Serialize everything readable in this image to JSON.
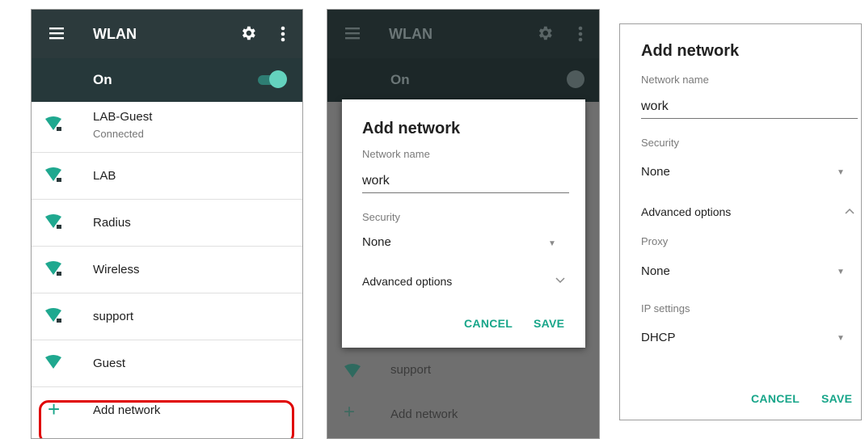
{
  "colors": {
    "appbar": "#2c3a3c",
    "accent": "#17a589",
    "wifi_icon": "#1fa88f",
    "highlight": "#e00000"
  },
  "wlan_screen": {
    "title": "WLAN",
    "status": "On",
    "networks": [
      {
        "name": "LAB-Guest",
        "status": "Connected"
      },
      {
        "name": "LAB"
      },
      {
        "name": "Radius"
      },
      {
        "name": "Wireless"
      },
      {
        "name": "support"
      },
      {
        "name": "Guest"
      }
    ],
    "add_network": "Add network"
  },
  "background_screen": {
    "title": "WLAN",
    "status": "On",
    "support": "support",
    "add_network": "Add network"
  },
  "dialog_basic": {
    "title": "Add network",
    "network_name_label": "Network name",
    "network_name_value": "work",
    "security_label": "Security",
    "security_value": "None",
    "advanced_label": "Advanced options",
    "cancel": "CANCEL",
    "save": "SAVE"
  },
  "dialog_advanced": {
    "title": "Add network",
    "network_name_label": "Network name",
    "network_name_value": "work",
    "security_label": "Security",
    "security_value": "None",
    "advanced_label": "Advanced options",
    "proxy_label": "Proxy",
    "proxy_value": "None",
    "ip_label": "IP settings",
    "ip_value": "DHCP",
    "cancel": "CANCEL",
    "save": "SAVE"
  }
}
